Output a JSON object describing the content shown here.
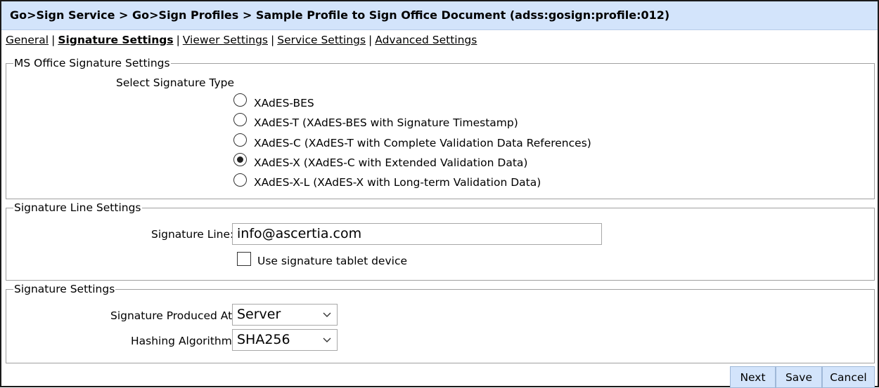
{
  "header": {
    "title": "Go>Sign Service > Go>Sign Profiles > Sample Profile to Sign Office Document (adss:gosign:profile:012)"
  },
  "tabs": [
    {
      "label": "General",
      "active": false
    },
    {
      "label": "Signature Settings",
      "active": true
    },
    {
      "label": "Viewer Settings",
      "active": false
    },
    {
      "label": "Service Settings",
      "active": false
    },
    {
      "label": "Advanced Settings",
      "active": false
    }
  ],
  "tab_separator": "|",
  "ms_office": {
    "legend": "MS Office Signature Settings",
    "select_label": "Select Signature Type",
    "options": [
      {
        "label": "XAdES-BES",
        "checked": false
      },
      {
        "label": "XAdES-T (XAdES-BES with Signature Timestamp)",
        "checked": false
      },
      {
        "label": "XAdES-C (XAdES-T with Complete Validation Data References)",
        "checked": false
      },
      {
        "label": "XAdES-X (XAdES-C with Extended Validation Data)",
        "checked": true
      },
      {
        "label": "XAdES-X-L (XAdES-X with Long-term Validation Data)",
        "checked": false
      }
    ]
  },
  "signature_line": {
    "legend": "Signature Line Settings",
    "label": "Signature Line:",
    "value": "info@ascertia.com",
    "tablet_label": "Use signature tablet device",
    "tablet_checked": false
  },
  "signature_settings": {
    "legend": "Signature Settings",
    "produced_label": "Signature Produced At:",
    "produced_value": "Server",
    "hash_label": "Hashing Algorithm:",
    "hash_value": "SHA256"
  },
  "buttons": {
    "next": "Next",
    "save": "Save",
    "cancel": "Cancel"
  }
}
